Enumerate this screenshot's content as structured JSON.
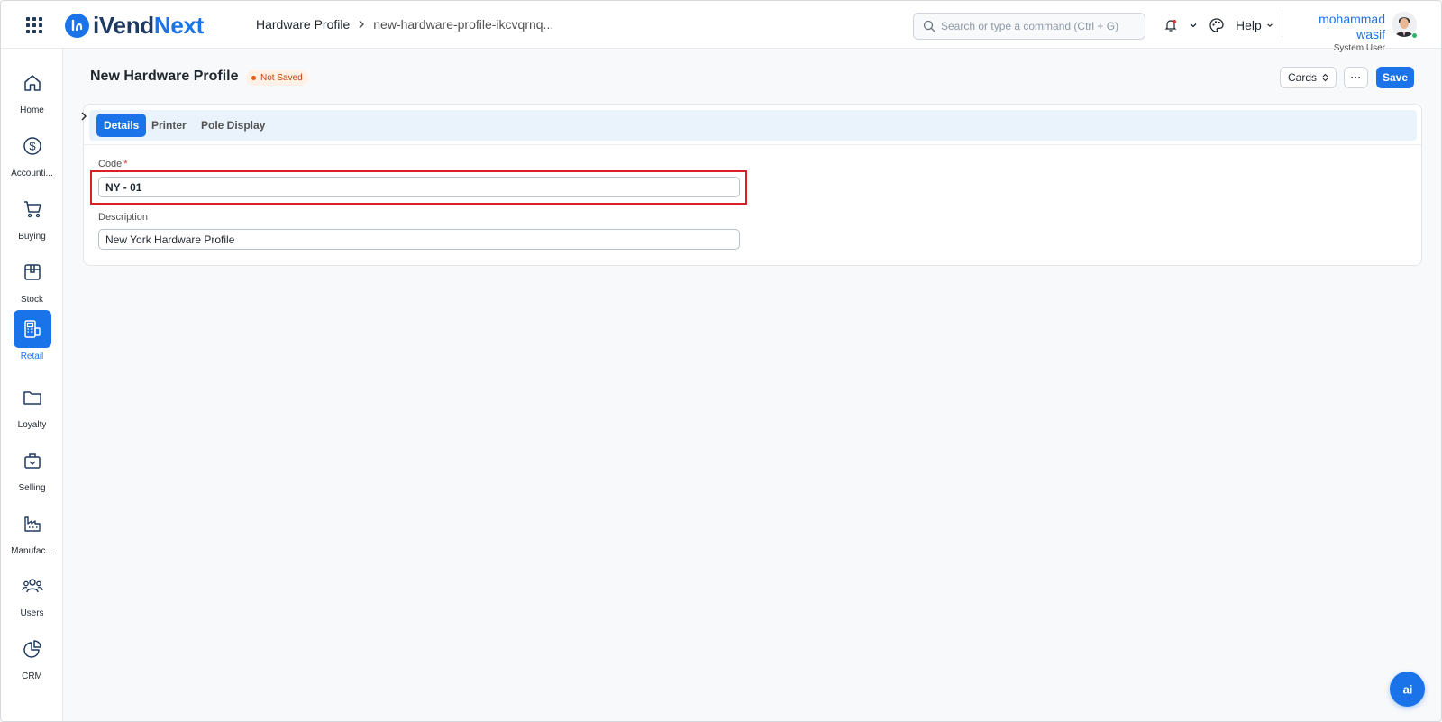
{
  "app": {
    "logo_part1": "iVend",
    "logo_part2": "Next",
    "brand_color": "#1a73e8"
  },
  "breadcrumb": {
    "items": [
      "Hardware Profile",
      "new-hardware-profile-ikcvqrnq..."
    ]
  },
  "search": {
    "placeholder": "Search or type a command (Ctrl + G)"
  },
  "navbar": {
    "help_label": "Help",
    "user_name": "mohammad wasif",
    "user_role": "System User"
  },
  "sidebar": {
    "items": [
      {
        "label": "Home",
        "icon": "home-icon"
      },
      {
        "label": "Accounti...",
        "icon": "dollar-icon"
      },
      {
        "label": "Buying",
        "icon": "cart-icon"
      },
      {
        "label": "Stock",
        "icon": "box-icon"
      },
      {
        "label": "Retail",
        "icon": "pos-terminal-icon",
        "active": true
      },
      {
        "label": "Loyalty",
        "icon": "folder-icon"
      },
      {
        "label": "Selling",
        "icon": "shopping-bag-icon"
      },
      {
        "label": "Manufac...",
        "icon": "factory-icon"
      },
      {
        "label": "Users",
        "icon": "users-icon"
      },
      {
        "label": "CRM",
        "icon": "pie-chart-icon"
      }
    ]
  },
  "page": {
    "title": "New Hardware Profile",
    "status": "Not Saved",
    "cards_label": "Cards",
    "more_label": "···",
    "save_label": "Save"
  },
  "tabs": [
    {
      "label": "Details",
      "active": true
    },
    {
      "label": "Printer",
      "active": false
    },
    {
      "label": "Pole Display",
      "active": false
    }
  ],
  "form": {
    "code_label": "Code",
    "code_required": "*",
    "code_value": "NY - 01",
    "description_label": "Description",
    "description_value": "New York Hardware Profile"
  },
  "ai_button": {
    "label": "ai"
  }
}
